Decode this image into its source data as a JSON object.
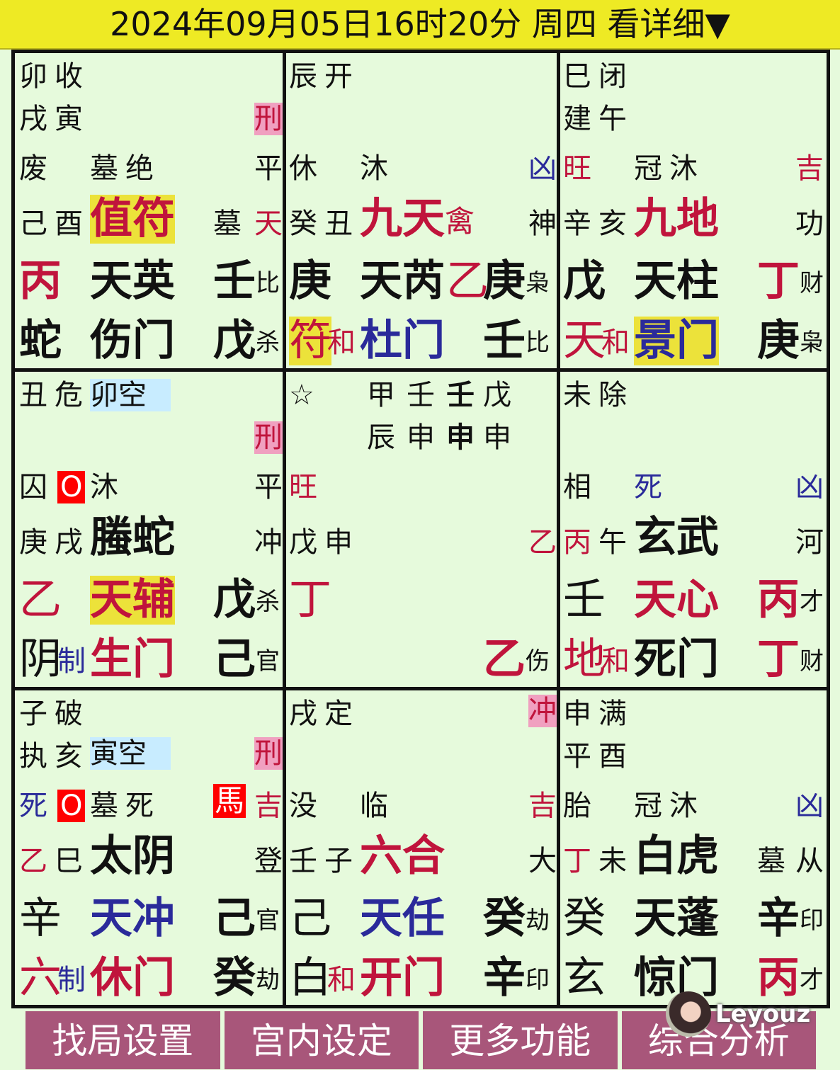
{
  "header": {
    "title": "2024年09月05日16时20分 周四 看详细▼"
  },
  "cells": {
    "c0": {
      "r1a": "卯",
      "r1b": "收",
      "r2a": "戌",
      "r2b": "寅",
      "mark1": "刑",
      "r3a": "废",
      "r3b": "墓",
      "r3c": "绝",
      "r3d": "平",
      "r4a": "己",
      "r4b": "酉",
      "god": "值符",
      "r4c": "墓",
      "r4d": "天",
      "stem": "丙",
      "star": "天英",
      "s1": "壬",
      "s1l": "比",
      "deity": "蛇",
      "door": "伤门",
      "s2": "戊",
      "s2l": "杀"
    },
    "c1": {
      "r1a": "辰",
      "r1b": "开",
      "r3a": "休",
      "r3b": "沐",
      "r3d": "凶",
      "r4a": "癸",
      "r4b": "丑",
      "god": "九天",
      "god2": "禽",
      "r4d": "神",
      "stem": "庚",
      "star": "天芮",
      "s0": "乙",
      "s1": "庚",
      "s1l": "枭",
      "deity": "符",
      "he": "和",
      "door": "杜门",
      "s2": "壬",
      "s2l": "比"
    },
    "c2": {
      "r1a": "巳",
      "r1b": "闭",
      "r2a": "建",
      "r2b": "午",
      "r3a": "旺",
      "r3b": "冠",
      "r3c": "沐",
      "r3d": "吉",
      "r4a": "辛",
      "r4b": "亥",
      "god": "九地",
      "r4d": "功",
      "stem": "戊",
      "star": "天柱",
      "s1": "丁",
      "s1l": "财",
      "deity": "天",
      "he": "和",
      "door": "景门",
      "s2": "庚",
      "s2l": "枭"
    },
    "c3": {
      "r1a": "丑",
      "r1b": "危",
      "kong": "卯空",
      "mark1": "刑",
      "r3a": "囚",
      "circ": "O",
      "r3c": "沐",
      "r3d": "平",
      "r4a": "庚",
      "r4b": "戌",
      "god": "螣蛇",
      "r4d": "冲",
      "stem": "乙",
      "star": "天辅",
      "s1": "戊",
      "s1l": "杀",
      "deity": "阴",
      "he": "制",
      "door": "生门",
      "s2": "己",
      "s2l": "官"
    },
    "c4": {
      "starIcon": "☆",
      "g1": "甲",
      "g2": "壬",
      "g3": "壬",
      "g4": "戊",
      "z1": "辰",
      "z2": "申",
      "z3": "申",
      "z4": "申",
      "r3a": "旺",
      "r4a": "戊",
      "r4b": "申",
      "r4d": "乙",
      "stem": "丁",
      "s2": "乙",
      "s2l": "伤"
    },
    "c5": {
      "r1a": "未",
      "r1b": "除",
      "r3a": "相",
      "r3b": "死",
      "r3d": "凶",
      "r4a": "丙",
      "r4b": "午",
      "god": "玄武",
      "r4d": "河",
      "stem": "壬",
      "star": "天心",
      "s1": "丙",
      "s1l": "才",
      "deity": "地",
      "he": "和",
      "door": "死门",
      "s2": "丁",
      "s2l": "财"
    },
    "c6": {
      "r1a": "子",
      "r1b": "破",
      "r2a": "执",
      "r2b": "亥",
      "kong": "寅空",
      "mark1": "刑",
      "r3a": "死",
      "circ": "O",
      "r3b": "墓",
      "r3c": "死",
      "horse": "馬",
      "r3d": "吉",
      "r4a": "乙",
      "r4b": "巳",
      "god": "太阴",
      "r4d": "登",
      "stem": "辛",
      "star": "天冲",
      "s1": "己",
      "s1l": "官",
      "deity": "六",
      "he": "制",
      "door": "休门",
      "s2": "癸",
      "s2l": "劫"
    },
    "c7": {
      "r1a": "戌",
      "r1b": "定",
      "mark1": "冲",
      "r3a": "没",
      "r3b": "临",
      "r3d": "吉",
      "r4a": "壬",
      "r4b": "子",
      "god": "六合",
      "r4d": "大",
      "stem": "己",
      "star": "天任",
      "s1": "癸",
      "s1l": "劫",
      "deity": "白",
      "he": "和",
      "door": "开门",
      "s2": "辛",
      "s2l": "印"
    },
    "c8": {
      "r1a": "申",
      "r1b": "满",
      "r2a": "平",
      "r2b": "酉",
      "r3a": "胎",
      "r3b": "冠",
      "r3c": "沐",
      "r3d": "凶",
      "r4a": "丁",
      "r4b": "未",
      "god": "白虎",
      "r4c": "墓",
      "r4d": "从",
      "stem": "癸",
      "star": "天蓬",
      "s1": "辛",
      "s1l": "印",
      "deity": "玄",
      "door": "惊门",
      "s2": "丙",
      "s2l": "才"
    }
  },
  "buttons": [
    "找局设置",
    "宫内设定",
    "更多功能",
    "综合分析"
  ],
  "watermark": {
    "text": "Leyouz"
  }
}
